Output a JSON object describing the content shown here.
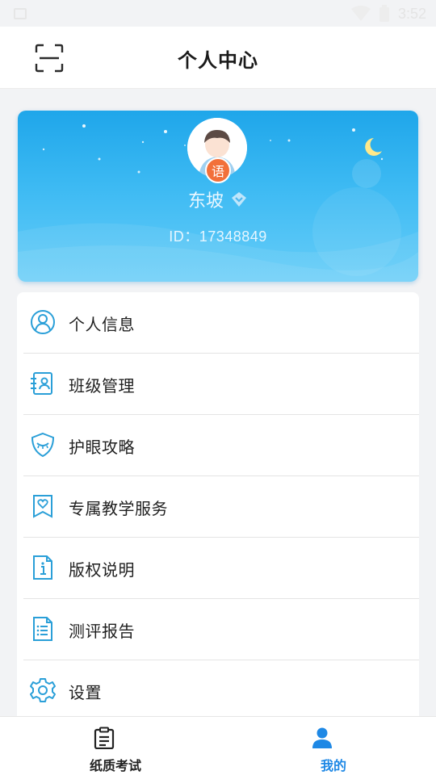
{
  "status_bar": {
    "time": "3:52"
  },
  "header": {
    "title": "个人中心"
  },
  "profile": {
    "name": "东坡",
    "id_text": "ID：17348849",
    "subject_badge": "语"
  },
  "menu": [
    {
      "label": "个人信息",
      "icon": "user-circle-icon"
    },
    {
      "label": "班级管理",
      "icon": "class-roster-icon"
    },
    {
      "label": "护眼攻略",
      "icon": "eye-shield-icon"
    },
    {
      "label": "专属教学服务",
      "icon": "heart-bookmark-icon"
    },
    {
      "label": "版权说明",
      "icon": "info-document-icon"
    },
    {
      "label": "测评报告",
      "icon": "report-document-icon"
    },
    {
      "label": "设置",
      "icon": "gear-icon"
    }
  ],
  "bottom_nav": {
    "tabs": [
      {
        "label": "纸质考试",
        "icon": "clipboard-icon",
        "active": false
      },
      {
        "label": "我的",
        "icon": "person-icon",
        "active": true
      }
    ]
  },
  "colors": {
    "accent": "#1e88e5",
    "icon_blue": "#2a9fd8",
    "card_top": "#1fa6ea",
    "card_bottom": "#66cdf8",
    "badge_orange": "#f2703a"
  }
}
